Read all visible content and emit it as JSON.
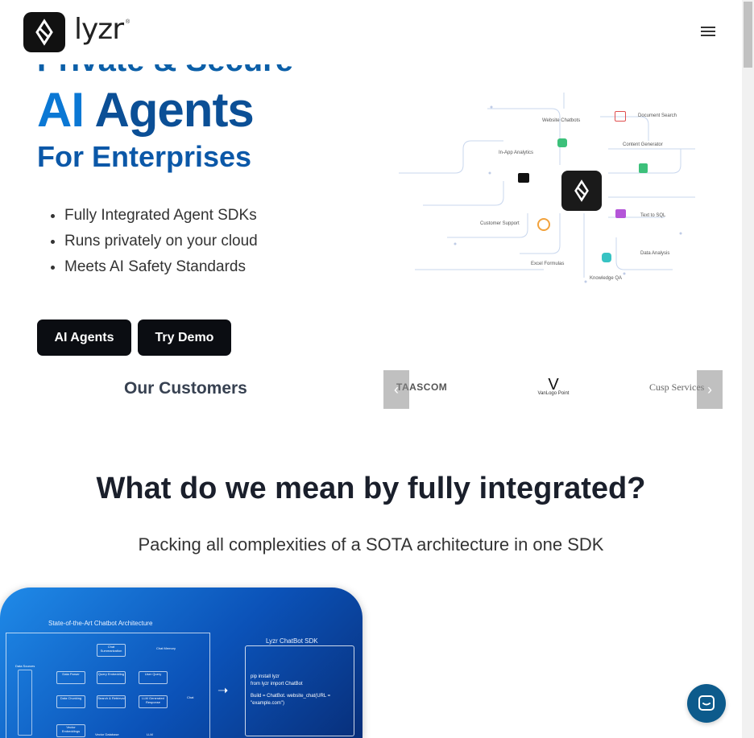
{
  "header": {
    "logo_text": "lyzr",
    "logo_tm": "®",
    "menu_icon": "hamburger-menu-icon"
  },
  "hero": {
    "top_line": "Private & Secure",
    "title_part1": "AI",
    "title_part2": "Agents",
    "subtitle": "For Enterprises",
    "bullets": [
      "Fully Integrated Agent SDKs",
      "Runs privately on your cloud",
      "Meets AI Safety Standards"
    ],
    "buttons": {
      "agents": "AI Agents",
      "demo": "Try Demo"
    }
  },
  "diagram": {
    "nodes": {
      "website_chatbots": "Website Chatbots",
      "document_search": "Document Search",
      "in_app_analytics": "In-App Analytics",
      "content_generator": "Content Generator",
      "customer_support": "Customer Support",
      "text_to_sql": "Text to SQL",
      "excel_formulas": "Excel Formulas",
      "data_analysis": "Data Analysis",
      "knowledge_qa": "Knowledge QA"
    }
  },
  "customers": {
    "title": "Our Customers",
    "logos": [
      "TAASCOM",
      "VanLogo Point",
      "Cusp Services"
    ],
    "prev_icon": "chevron-left-icon",
    "next_icon": "chevron-right-icon"
  },
  "section2": {
    "title": "What do we mean by fully integrated?",
    "subtitle": "Packing all complexities of a SOTA architecture in one SDK"
  },
  "architecture": {
    "left_title": "State-of-the-Art Chatbot Architecture",
    "right_title": "Lyzr ChatBot SDK",
    "code_line1": "pip install lyzr",
    "code_line2": "from lyzr import ChatBot",
    "code_line3": "Build = ChatBot. website_chat(URL =",
    "code_line4": "\"example.com\")",
    "blocks": {
      "chat_summarization": "Chat Summarization",
      "chat_memory": "Chat Memory",
      "data_parser": "Data Parser",
      "query_embedding": "Query Embedding",
      "user_query": "User Query",
      "data_chunking": "Data Chunking",
      "search_retrieval": "Search & Retrieval",
      "llm_response": "LLM Generated Response",
      "vector_embeddings": "Vector Embeddings",
      "vector_database": "Vector Database",
      "llm": "LLM",
      "chat": "Chat",
      "data_sources": "Data Sources"
    }
  },
  "chat_widget": {
    "icon": "chat-bubble-icon"
  },
  "colors": {
    "primary_dark": "#0b4f96",
    "primary_light": "#0b78d4",
    "button_bg": "#0b0d12",
    "chat_widget": "#0d5b8c"
  }
}
